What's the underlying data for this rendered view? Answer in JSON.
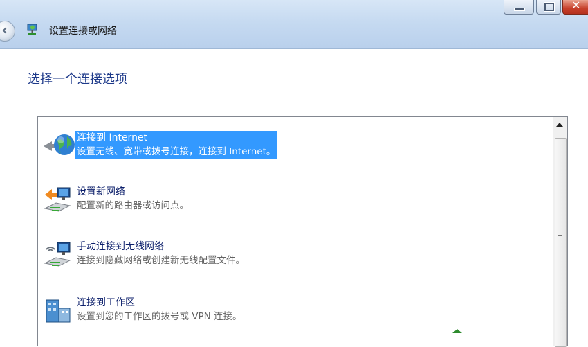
{
  "window": {
    "title": "设置连接或网络",
    "controls": {
      "minimize": "minimize-icon",
      "maximize": "maximize-icon",
      "close": "close-icon"
    }
  },
  "page": {
    "heading": "选择一个连接选项"
  },
  "options": [
    {
      "title": "连接到 Internet",
      "description": "设置无线、宽带或拨号连接，连接到 Internet。",
      "icon": "globe-icon",
      "selected": true
    },
    {
      "title": "设置新网络",
      "description": "配置新的路由器或访问点。",
      "icon": "new-network-icon",
      "selected": false
    },
    {
      "title": "手动连接到无线网络",
      "description": "连接到隐藏网络或创建新无线配置文件。",
      "icon": "wireless-network-icon",
      "selected": false
    },
    {
      "title": "连接到工作区",
      "description": "设置到您的工作区的拨号或 VPN 连接。",
      "icon": "workplace-icon",
      "selected": false
    }
  ],
  "colors": {
    "selection": "#3399ff",
    "heading": "#1e3a8a",
    "titlebar": "#c6daf1"
  }
}
